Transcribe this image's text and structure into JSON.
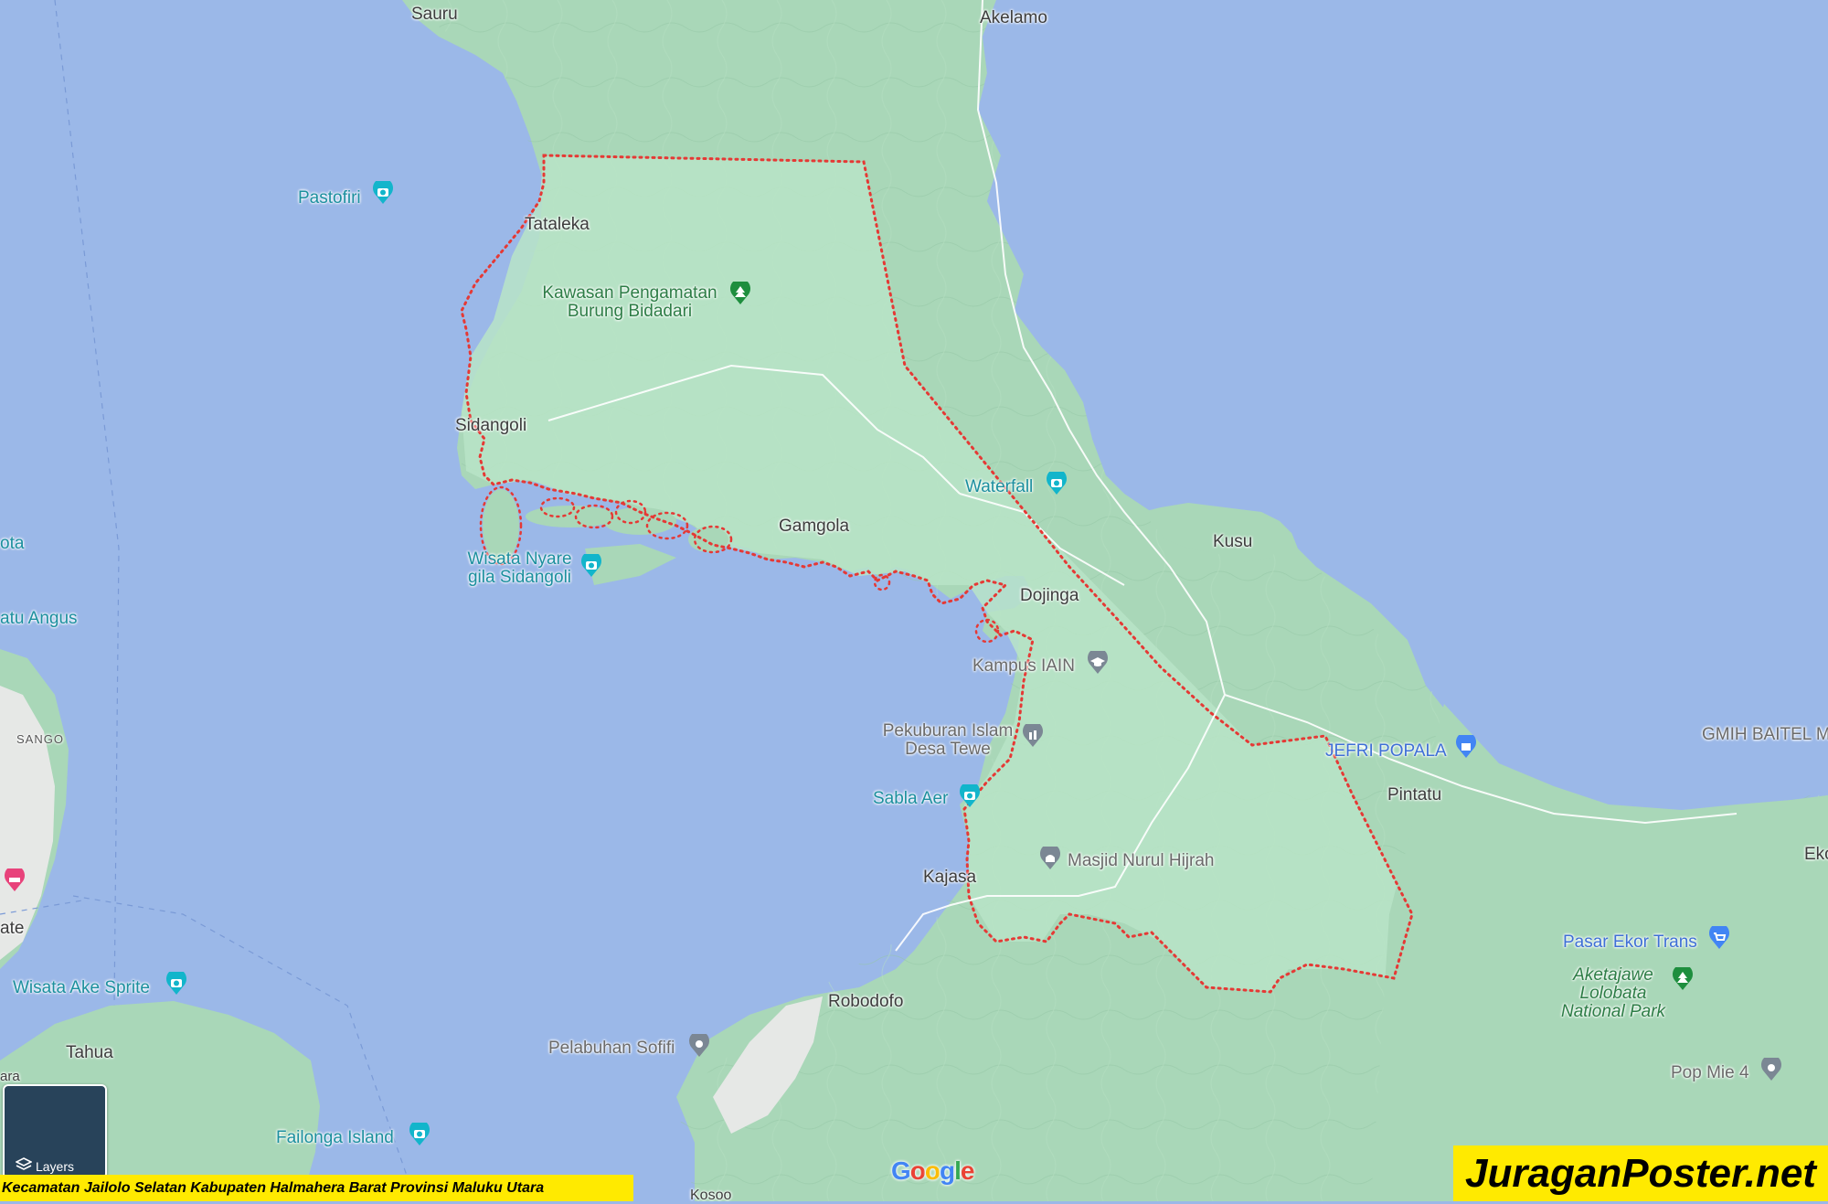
{
  "colors": {
    "water": "#9bb8e8",
    "land": "#a9d7b8",
    "land_highlight": "#b9e4c7",
    "boundary": "#e53935",
    "urban": "#e6e8e6",
    "road": "#ffffff"
  },
  "labels": {
    "sauru": "Sauru",
    "akelamo": "Akelamo",
    "pastofiri": "Pastofiri",
    "tataleka": "Tataleka",
    "kawasan": "Kawasan Pengamatan Burung Bidadari",
    "sidangoli": "Sidangoli",
    "waterfall": "Waterfall",
    "gamgola": "Gamgola",
    "kusu": "Kusu",
    "wisata_nyare": "Wisata Nyare gila Sidangoli",
    "ota": "ota",
    "satu_angus": "atu Angus",
    "dojinga": "Dojinga",
    "kampus_iain": "Kampus IAIN",
    "sango": "SANGO",
    "pekuburan": "Pekuburan Islam Desa Tewe",
    "jefri_popala": "JEFRI POPALA",
    "gmih_baitel": "GMIH BAITEL M",
    "sabla_aer": "Sabla Aer",
    "pintatu": "Pintatu",
    "masjid": "Masjid Nurul Hijrah",
    "kajasa": "Kajasa",
    "eko": "Eko",
    "ate": "ate",
    "pasar_ekor": "Pasar Ekor Trans",
    "wisata_ake": "Wisata Ake Sprite",
    "aketajawe": "Aketajawe Lolobata National Park",
    "robodofo": "Robodofo",
    "tahua": "Tahua",
    "pelabuhan": "Pelabuhan Sofifi",
    "pop_mie": "Pop Mie 4",
    "failonga": "Failonga Island",
    "ara": "ara",
    "kosoo": "Kosoo"
  },
  "layers_button": {
    "label": "Layers",
    "icon": "layers-icon"
  },
  "google_logo": "Google",
  "caption": "Kecamatan Jailolo Selatan Kabupaten Halmahera Barat Provinsi Maluku Utara",
  "brand": "JuraganPoster.net"
}
